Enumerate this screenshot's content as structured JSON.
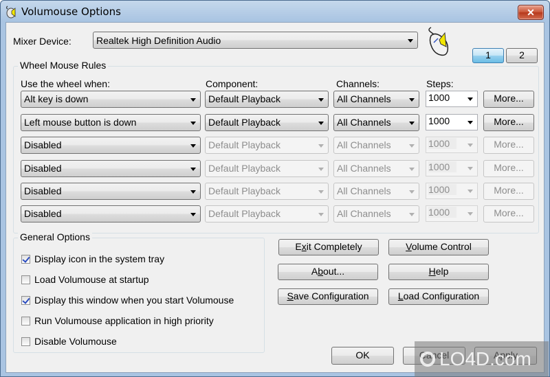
{
  "window": {
    "title": "Volumouse Options",
    "close_label": "✕"
  },
  "mixer": {
    "label": "Mixer Device:",
    "value": "Realtek High Definition Audio"
  },
  "pages": [
    {
      "label": "1",
      "active": true
    },
    {
      "label": "2",
      "active": false
    }
  ],
  "rules": {
    "group_title": "Wheel Mouse Rules",
    "headers": {
      "condition": "Use the wheel when:",
      "component": "Component:",
      "channels": "Channels:",
      "steps": "Steps:"
    },
    "rows": [
      {
        "condition": "Alt key is down",
        "component": "Default Playback",
        "channels": "All Channels",
        "steps": "1000",
        "more": "More...",
        "enabled": true
      },
      {
        "condition": "Left mouse button is down",
        "component": "Default Playback",
        "channels": "All Channels",
        "steps": "1000",
        "more": "More...",
        "enabled": true
      },
      {
        "condition": "Disabled",
        "component": "Default Playback",
        "channels": "All Channels",
        "steps": "1000",
        "more": "More...",
        "enabled": false
      },
      {
        "condition": "Disabled",
        "component": "Default Playback",
        "channels": "All Channels",
        "steps": "1000",
        "more": "More...",
        "enabled": false
      },
      {
        "condition": "Disabled",
        "component": "Default Playback",
        "channels": "All Channels",
        "steps": "1000",
        "more": "More...",
        "enabled": false
      },
      {
        "condition": "Disabled",
        "component": "Default Playback",
        "channels": "All Channels",
        "steps": "1000",
        "more": "More...",
        "enabled": false
      }
    ]
  },
  "general": {
    "group_title": "General Options",
    "options": [
      {
        "label": "Display icon in the system tray",
        "checked": true
      },
      {
        "label": "Load Volumouse at startup",
        "checked": false
      },
      {
        "label": "Display this window when you start Volumouse",
        "checked": true
      },
      {
        "label": "Run Volumouse application in high priority",
        "checked": false
      },
      {
        "label": "Disable Volumouse",
        "checked": false
      }
    ]
  },
  "actions": {
    "exit": {
      "pre": "E",
      "u": "x",
      "post": "it Completely"
    },
    "volume": {
      "pre": "",
      "u": "V",
      "post": "olume Control"
    },
    "about": {
      "pre": "A",
      "u": "b",
      "post": "out..."
    },
    "help": {
      "pre": "",
      "u": "H",
      "post": "elp"
    },
    "save": {
      "pre": "",
      "u": "S",
      "post": "ave Configuration"
    },
    "load": {
      "pre": "",
      "u": "L",
      "post": "oad Configuration"
    }
  },
  "footer": {
    "ok": "OK",
    "cancel": "Cancel",
    "apply": "Apply"
  },
  "watermark": {
    "text": "LO4D.com"
  }
}
